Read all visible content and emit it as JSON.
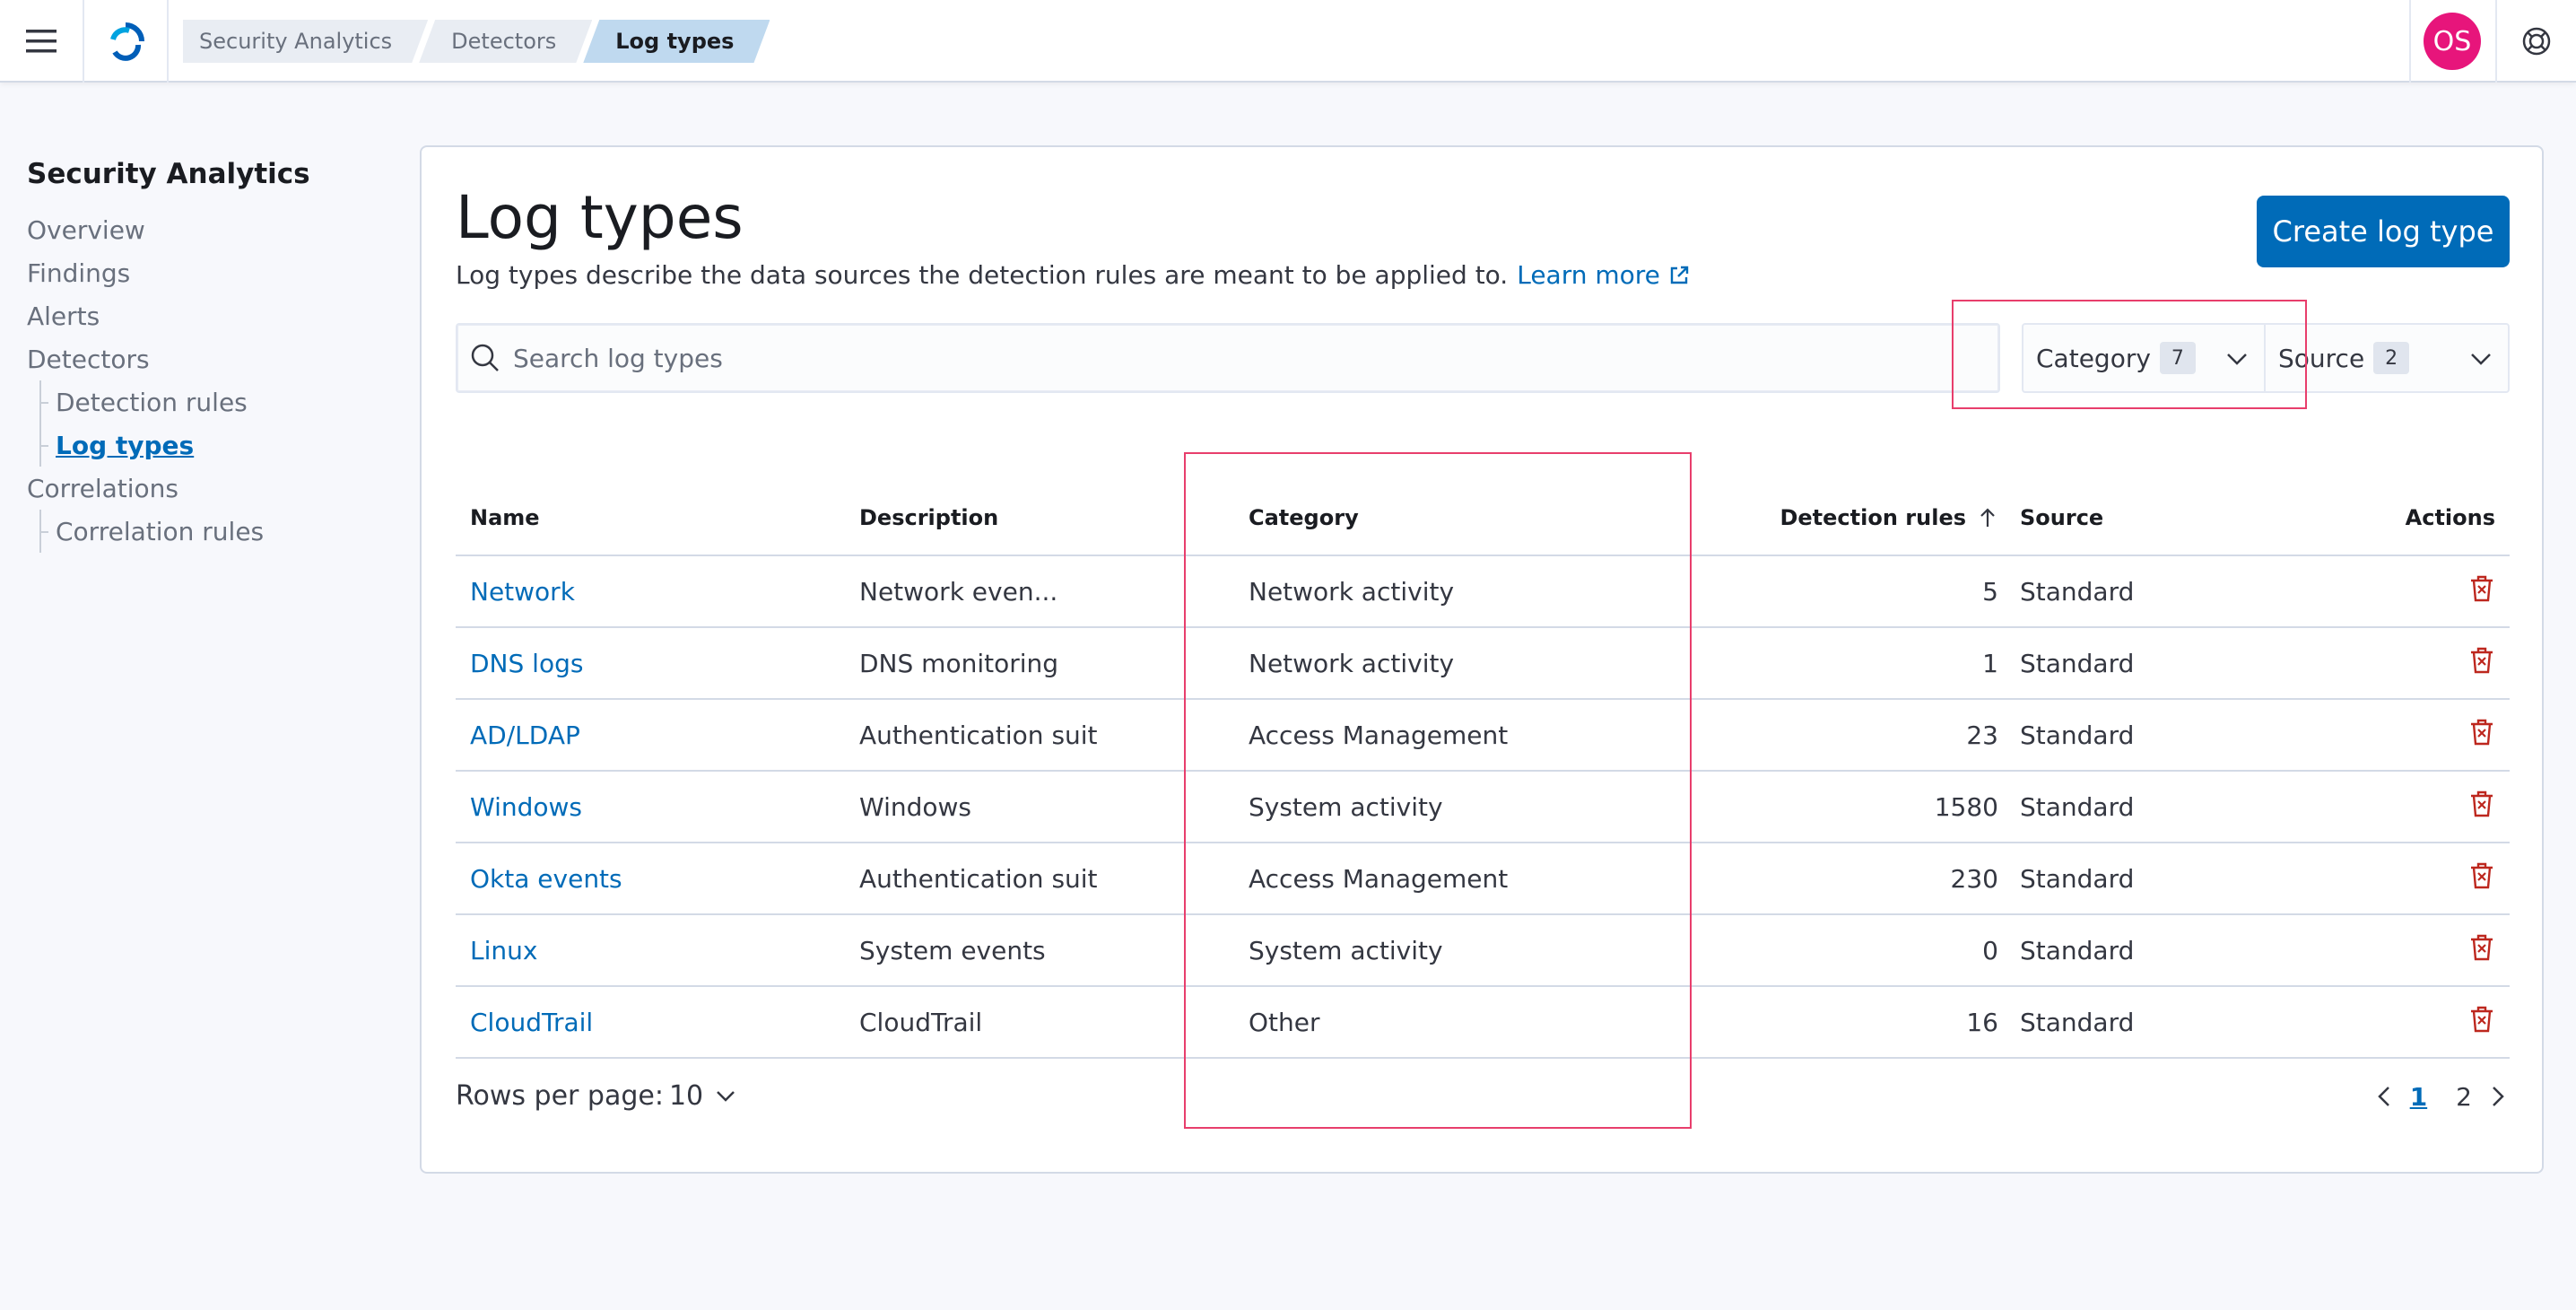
{
  "header": {
    "breadcrumbs": [
      "Security Analytics",
      "Detectors",
      "Log types"
    ],
    "avatar_initials": "OS",
    "avatar_color": "#e7157b"
  },
  "sidenav": {
    "title": "Security Analytics",
    "items": [
      {
        "label": "Overview",
        "level": 0
      },
      {
        "label": "Findings",
        "level": 0
      },
      {
        "label": "Alerts",
        "level": 0
      },
      {
        "label": "Detectors",
        "level": 0
      },
      {
        "label": "Detection rules",
        "level": 1
      },
      {
        "label": "Log types",
        "level": 1,
        "active": true
      },
      {
        "label": "Correlations",
        "level": 0
      },
      {
        "label": "Correlation rules",
        "level": 1
      }
    ]
  },
  "main": {
    "title": "Log types",
    "description": "Log types describe the data sources the detection rules are meant to be applied to.",
    "learn_more": "Learn more",
    "create_button": "Create log type",
    "search_placeholder": "Search log types",
    "filters": [
      {
        "label": "Category",
        "count": "7"
      },
      {
        "label": "Source",
        "count": "2"
      }
    ],
    "table": {
      "columns": [
        "Name",
        "Description",
        "Category",
        "Detection rules",
        "Source",
        "Actions"
      ],
      "sorted_column": "Detection rules",
      "sort_direction": "ascending",
      "rows": [
        {
          "name": "Network",
          "description": "Network even...",
          "category": "Network activity",
          "rules": "5",
          "source": "Standard"
        },
        {
          "name": "DNS logs",
          "description": "DNS monitoring",
          "category": "Network activity",
          "rules": "1",
          "source": "Standard"
        },
        {
          "name": "AD/LDAP",
          "description": "Authentication suit",
          "category": "Access Management",
          "rules": "23",
          "source": "Standard"
        },
        {
          "name": "Windows",
          "description": "Windows",
          "category": "System activity",
          "rules": "1580",
          "source": "Standard"
        },
        {
          "name": "Okta events",
          "description": "Authentication suit",
          "category": "Access Management",
          "rules": "230",
          "source": "Standard"
        },
        {
          "name": "Linux",
          "description": "System events",
          "category": "System activity",
          "rules": "0",
          "source": "Standard"
        },
        {
          "name": "CloudTrail",
          "description": "CloudTrail",
          "category": "Other",
          "rules": "16",
          "source": "Standard"
        }
      ]
    },
    "pagination": {
      "rows_per_page_label": "Rows per page:",
      "rows_per_page_value": "10",
      "pages": [
        "1",
        "2"
      ],
      "current_page": "1"
    }
  },
  "colors": {
    "link": "#006bb8",
    "primary_button": "#006bb8",
    "delete_icon": "#bd271e",
    "highlight": "#e83e6c"
  }
}
